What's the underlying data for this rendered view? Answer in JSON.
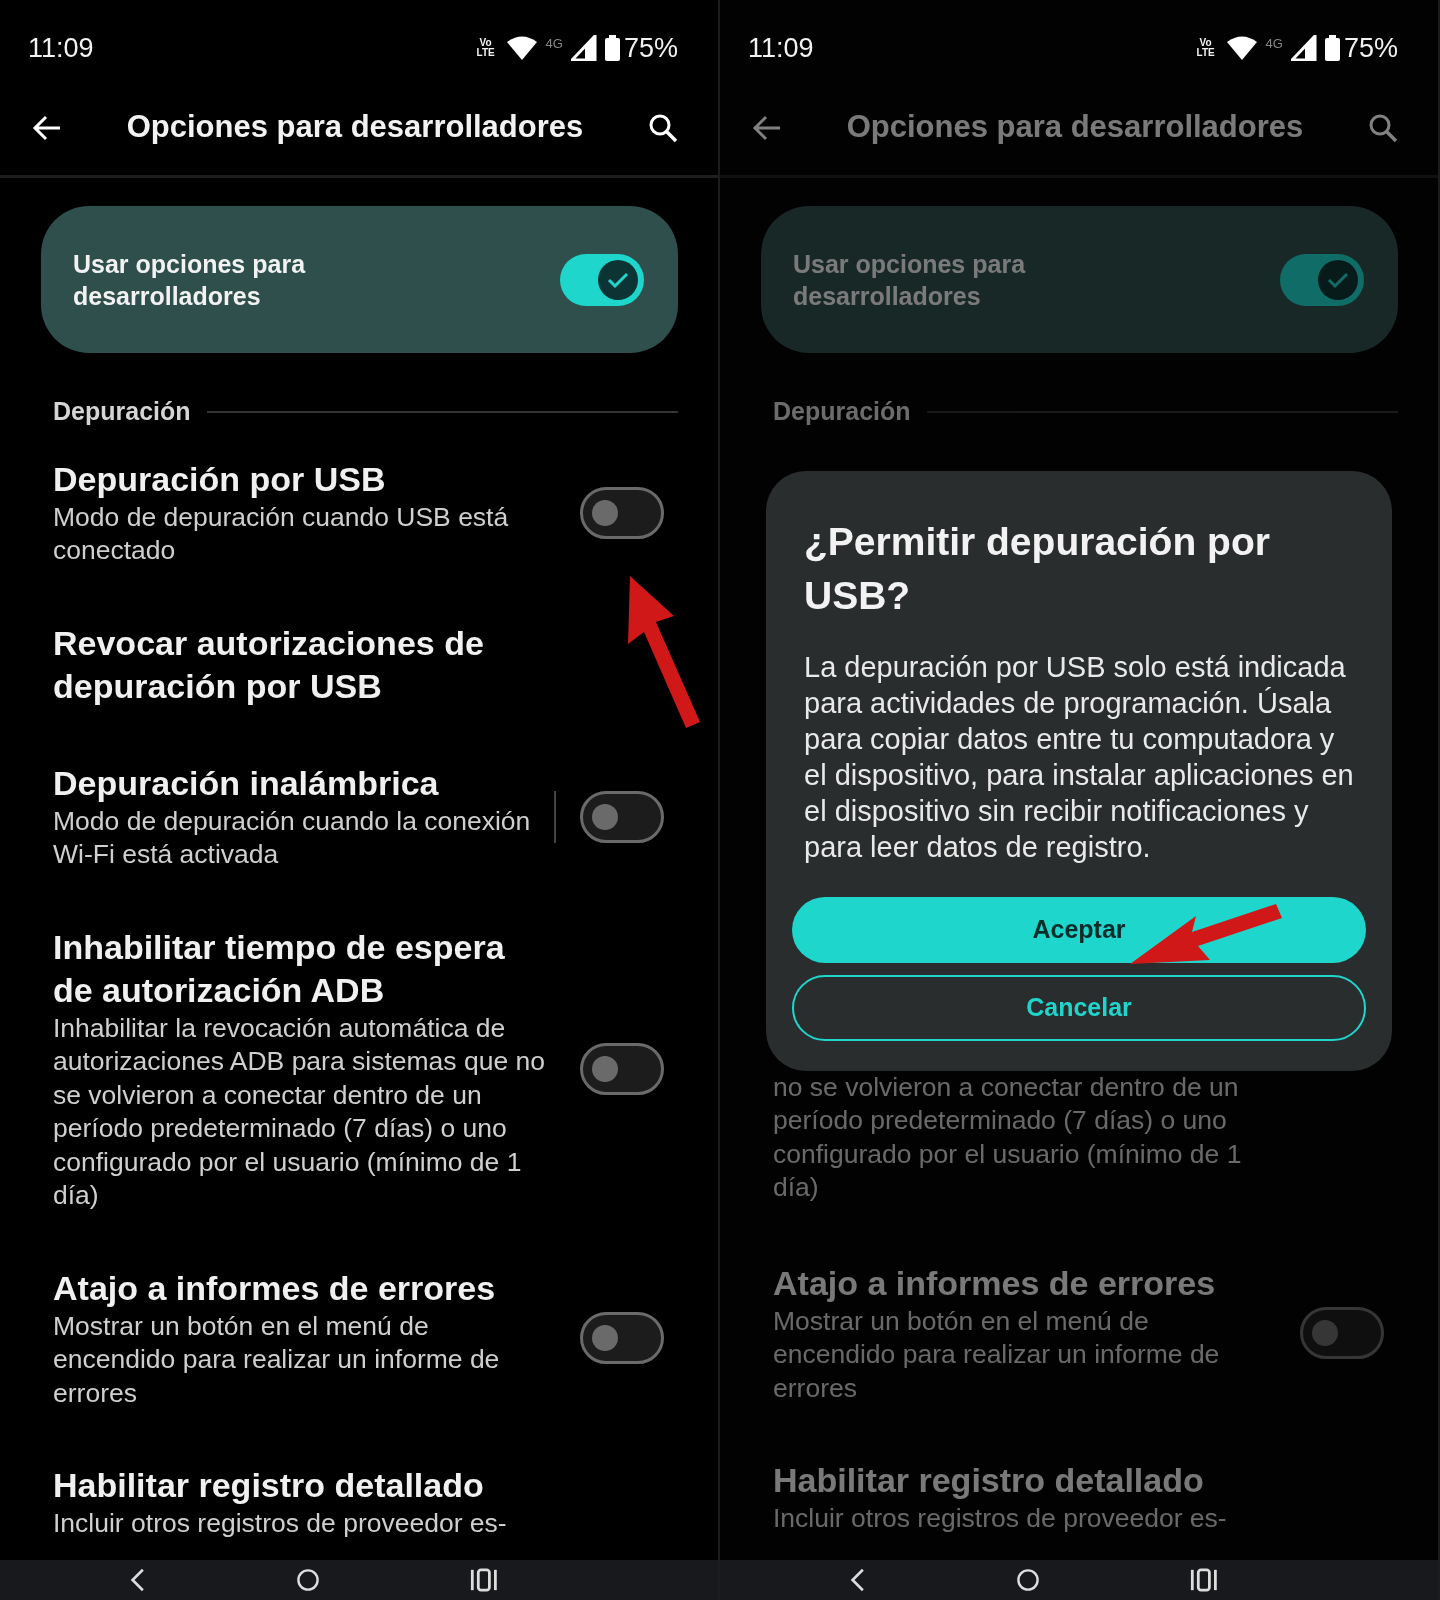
{
  "panels": [
    {
      "dimmed": false,
      "status_bar": {
        "time": "11:09",
        "volte": "Vo LTE",
        "network": "4G",
        "battery": "75%"
      },
      "app_bar": {
        "title": "Opciones para desarrolladores"
      },
      "master_switch": {
        "label": "Usar opciones para desarrolladores",
        "on": true
      },
      "section": "Depuración",
      "items": [
        {
          "kind": "switch",
          "title": "Depuración por USB",
          "description": "Modo de depuración cuando USB está conectado",
          "on": false,
          "divider": false
        },
        {
          "kind": "action",
          "title": "Revocar autorizaciones de depuración por USB"
        },
        {
          "kind": "switch",
          "title": "Depuración inalámbrica",
          "description": "Modo de depuración cuando la conexión Wi-Fi está activada",
          "on": false,
          "divider": true
        },
        {
          "kind": "switch",
          "title": "Inhabilitar tiempo de espera de autorización ADB",
          "description": "Inhabilitar la revocación automática de autorizaciones ADB para sistemas que no se volvieron a conectar dentro de un período predeterminado (7 días) o uno configurado por el usuario (mínimo de 1 día)",
          "on": false,
          "divider": false
        },
        {
          "kind": "switch",
          "title": "Atajo a informes de errores",
          "description": "Mostrar un botón en el menú de encendido para realizar un informe de errores",
          "on": false,
          "divider": false
        },
        {
          "kind": "cut",
          "title": "Habilitar registro detallado",
          "description": "Incluir otros registros de proveedor es-"
        }
      ]
    },
    {
      "dimmed": true,
      "status_bar": {
        "time": "11:09",
        "volte": "Vo LTE",
        "network": "4G",
        "battery": "75%"
      },
      "app_bar": {
        "title": "Opciones para desarrolladores"
      },
      "master_switch": {
        "label": "Usar opciones para desarrolladores",
        "on": true
      },
      "section": "Depuración",
      "dialog": {
        "title": "¿Permitir depuración por USB?",
        "body": "La depuración por USB solo está indicada para actividades de programación. Úsala para copiar datos entre tu computadora y el dispositivo, para instalar aplicaciones en el dispositivo sin recibir notificaciones y para leer datos de registro.",
        "buttons": [
          {
            "label": "Aceptar",
            "kind": "filled"
          },
          {
            "label": "Cancelar",
            "kind": "outlined"
          }
        ]
      },
      "items": [
        {
          "kind": "tail",
          "description": "no se volvieron a conectar dentro de un período predeterminado (7 días) o uno configurado por el usuario (mínimo de 1 día)"
        },
        {
          "kind": "switch",
          "title": "Atajo a informes de errores",
          "description": "Mostrar un botón en el menú de encendido para realizar un informe de errores",
          "on": false,
          "divider": false
        },
        {
          "kind": "cut",
          "title": "Habilitar registro detallado",
          "description": "Incluir otros registros de proveedor es-"
        }
      ]
    }
  ]
}
